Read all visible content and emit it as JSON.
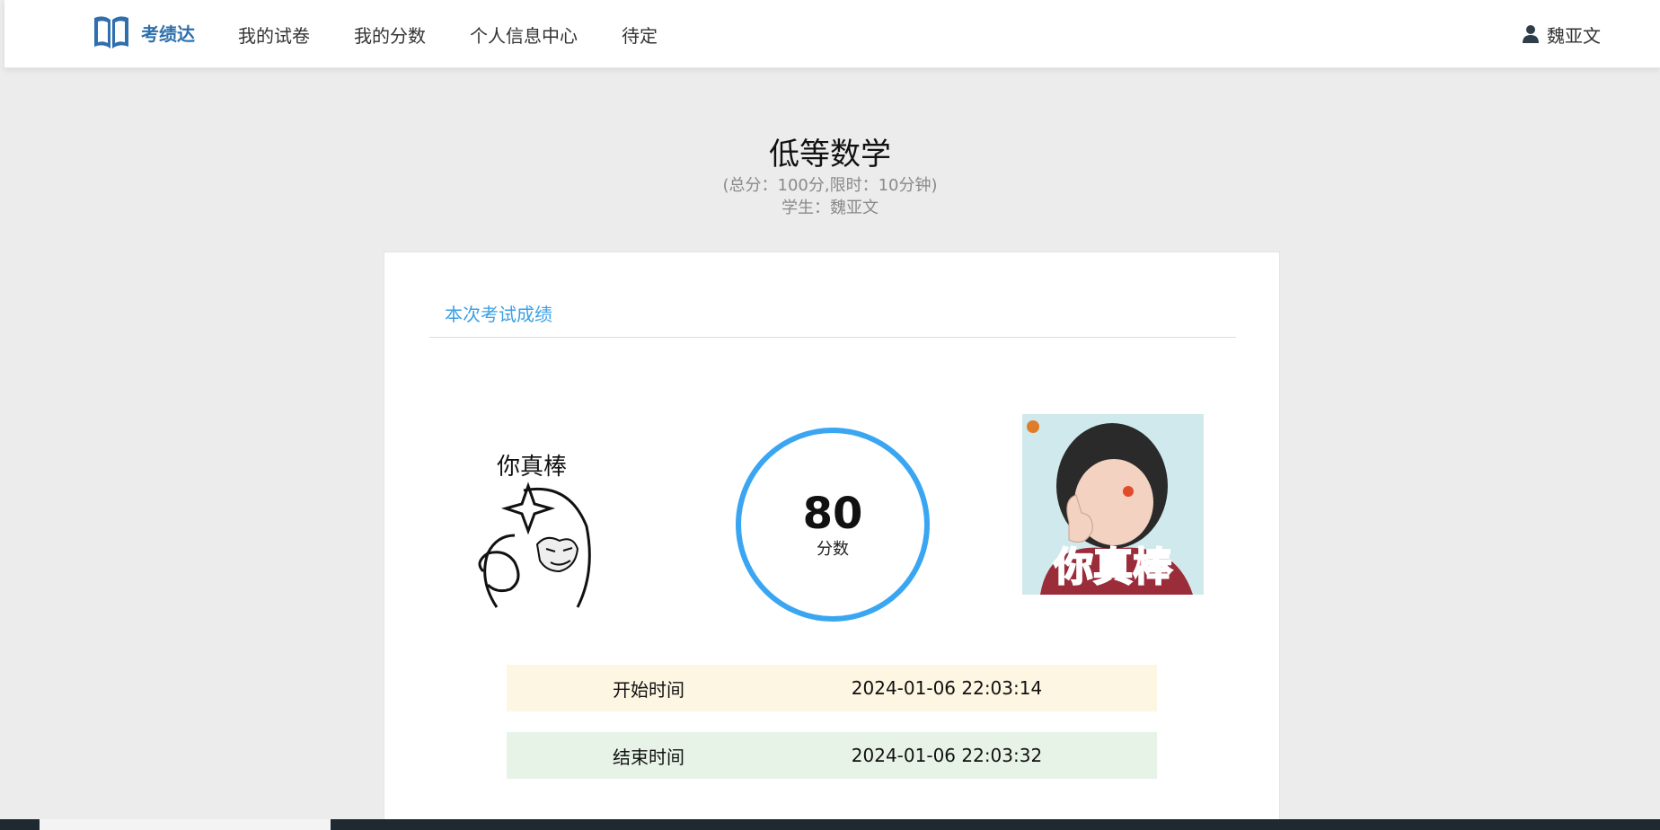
{
  "header": {
    "brand": "考绩达",
    "nav": [
      "我的试卷",
      "我的分数",
      "个人信息中心",
      "待定"
    ],
    "user": "魏亚文"
  },
  "exam": {
    "title": "低等数学",
    "subtitle": "(总分：100分,限时：10分钟)",
    "student": "学生：魏亚文"
  },
  "result": {
    "section_title": "本次考试成绩",
    "score": "80",
    "score_label": "分数",
    "meme_text": "你真棒",
    "start_label": "开始时间",
    "start_time": "2024-01-06 22:03:14",
    "end_label": "结束时间",
    "end_time": "2024-01-06 22:03:32"
  },
  "colors": {
    "brand": "#2f6fad",
    "accent": "#3aa0e6",
    "ring": "#3aa6f2",
    "start_row_bg": "#fdf6e3",
    "end_row_bg": "#e8f3e8"
  },
  "icons": [
    "book-logo-icon",
    "user-icon"
  ]
}
